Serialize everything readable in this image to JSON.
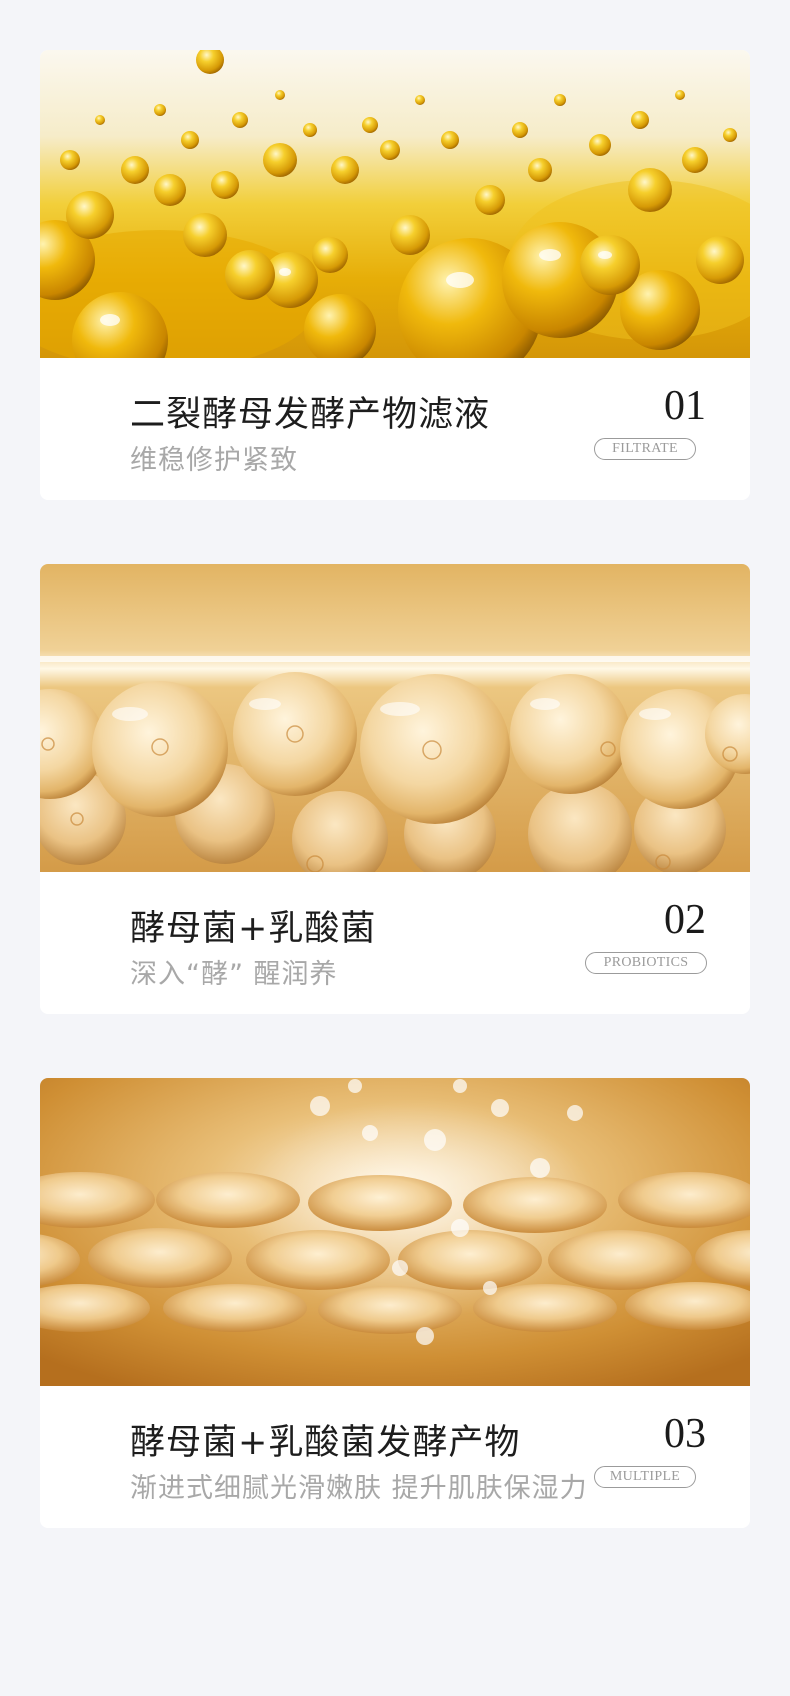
{
  "cards": [
    {
      "title": "二裂酵母发酵产物滤液",
      "subtitle": "维稳修护紧致",
      "number": "01",
      "tag": "FILTRATE",
      "image": "golden-oil-bubbles",
      "accent": "#e9b80c"
    },
    {
      "title": "酵母菌+乳酸菌",
      "subtitle": "深入“酵” 醒润养",
      "number": "02",
      "tag": "PROBIOTICS",
      "image": "amber-spheres",
      "accent": "#d9a456"
    },
    {
      "title": "酵母菌+乳酸菌发酵产物",
      "subtitle": "渐进式细腻光滑嫩肤 提升肌肤保湿力",
      "number": "03",
      "tag": "MULTIPLE",
      "image": "golden-capsules",
      "accent": "#c88a2e"
    }
  ]
}
